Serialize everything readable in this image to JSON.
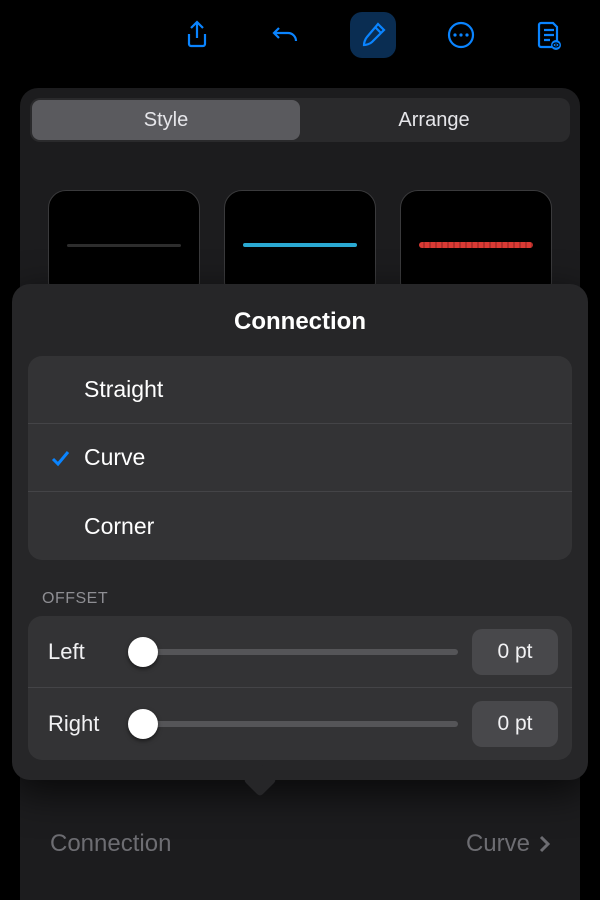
{
  "toolbar": {
    "icons": [
      "share-icon",
      "undo-icon",
      "format-brush-icon",
      "more-icon",
      "document-view-icon"
    ],
    "active": "format-brush-icon"
  },
  "tabs": {
    "items": [
      {
        "label": "Style",
        "selected": true
      },
      {
        "label": "Arrange",
        "selected": false
      }
    ]
  },
  "lineStyles": {
    "items": [
      {
        "name": "line-black"
      },
      {
        "name": "line-blue"
      },
      {
        "name": "line-red-rough"
      }
    ]
  },
  "sheet": {
    "title": "Connection",
    "options": [
      {
        "label": "Straight",
        "selected": false
      },
      {
        "label": "Curve",
        "selected": true
      },
      {
        "label": "Corner",
        "selected": false
      }
    ],
    "offset": {
      "sectionLabel": "OFFSET",
      "rows": [
        {
          "label": "Left",
          "value": "0 pt",
          "position": 0
        },
        {
          "label": "Right",
          "value": "0 pt",
          "position": 0
        }
      ]
    }
  },
  "underRow": {
    "label": "Connection",
    "value": "Curve"
  },
  "colors": {
    "accent": "#0a84ff"
  }
}
